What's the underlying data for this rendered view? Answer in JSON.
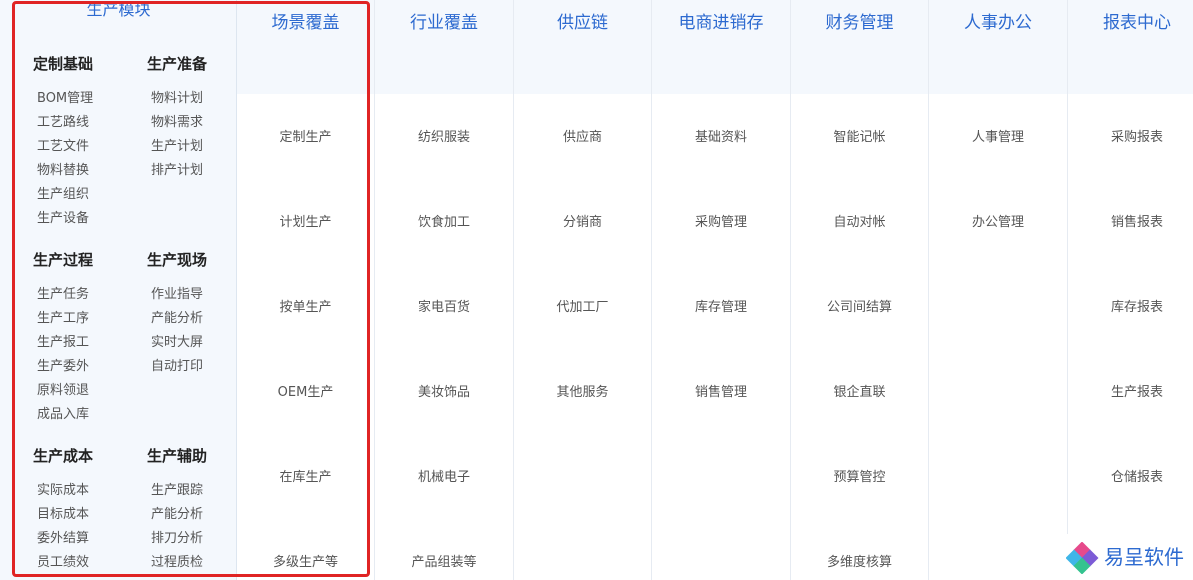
{
  "left": {
    "title": "生产模块",
    "groups": [
      {
        "title": "定制基础",
        "items": [
          "BOM管理",
          "工艺路线",
          "工艺文件",
          "物料替换",
          "生产组织",
          "生产设备"
        ]
      },
      {
        "title": "生产准备",
        "items": [
          "物料计划",
          "物料需求",
          "生产计划",
          "排产计划"
        ]
      },
      {
        "title": "生产过程",
        "items": [
          "生产任务",
          "生产工序",
          "生产报工",
          "生产委外",
          "原料领退",
          "成品入库"
        ]
      },
      {
        "title": "生产现场",
        "items": [
          "作业指导",
          "产能分析",
          "实时大屏",
          "自动打印"
        ]
      },
      {
        "title": "生产成本",
        "items": [
          "实际成本",
          "目标成本",
          "委外结算",
          "员工绩效"
        ]
      },
      {
        "title": "生产辅助",
        "items": [
          "生产跟踪",
          "产能分析",
          "排刀分析",
          "过程质检"
        ]
      }
    ]
  },
  "columns": [
    {
      "title": "场景覆盖",
      "items": [
        "定制生产",
        "计划生产",
        "按单生产",
        "OEM生产",
        "在库生产",
        "多级生产等"
      ]
    },
    {
      "title": "行业覆盖",
      "items": [
        "纺织服装",
        "饮食加工",
        "家电百货",
        "美妆饰品",
        "机械电子",
        "产品组装等"
      ]
    },
    {
      "title": "供应链",
      "items": [
        "供应商",
        "分销商",
        "代加工厂",
        "其他服务",
        "",
        ""
      ]
    },
    {
      "title": "电商进销存",
      "items": [
        "基础资料",
        "采购管理",
        "库存管理",
        "销售管理",
        "",
        ""
      ]
    },
    {
      "title": "财务管理",
      "items": [
        "智能记帐",
        "自动对帐",
        "公司间结算",
        "银企直联",
        "预算管控",
        "多维度核算"
      ]
    },
    {
      "title": "人事办公",
      "items": [
        "人事管理",
        "办公管理",
        "",
        "",
        "",
        ""
      ]
    },
    {
      "title": "报表中心",
      "items": [
        "采购报表",
        "销售报表",
        "库存报表",
        "生产报表",
        "仓储报表",
        ""
      ]
    }
  ],
  "logo": {
    "text": "易呈软件"
  },
  "colors": {
    "accent": "#2d6ad0",
    "highlight": "#e02424",
    "panel_bg": "#f4f8fd"
  }
}
